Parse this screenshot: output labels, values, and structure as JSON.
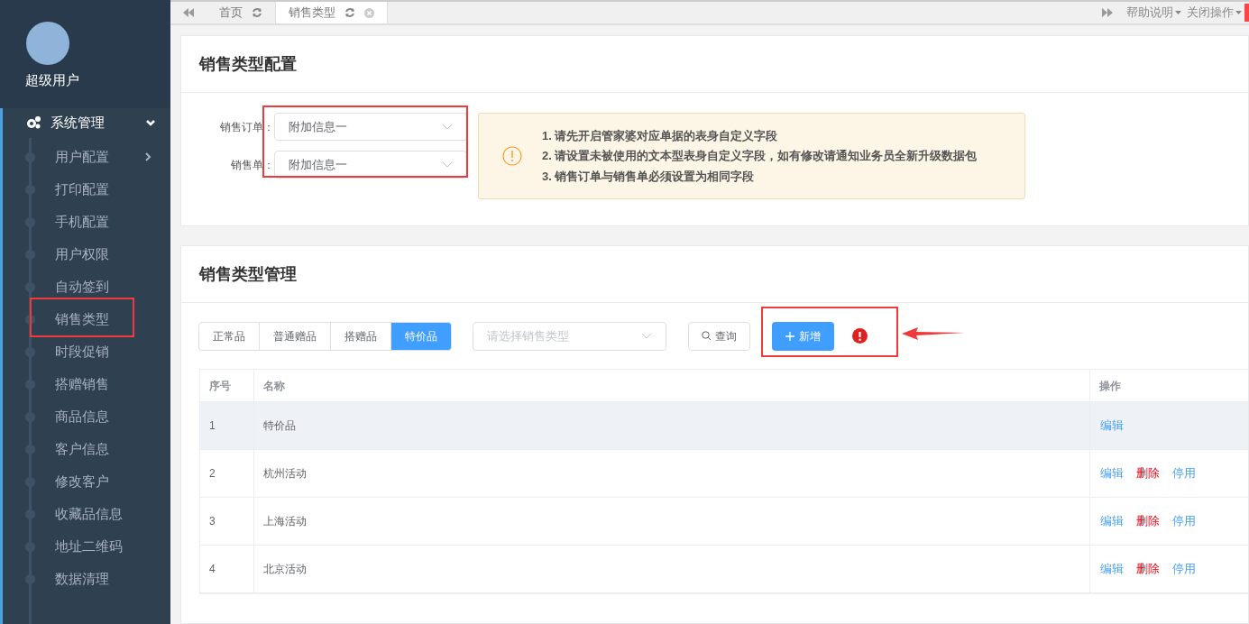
{
  "user": {
    "name": "超级用户"
  },
  "sidebar": {
    "group": {
      "label": "系统管理",
      "expanded": true
    },
    "items": [
      {
        "label": "用户配置",
        "has_children": true,
        "highlighted": false
      },
      {
        "label": "打印配置",
        "has_children": false,
        "highlighted": false
      },
      {
        "label": "手机配置",
        "has_children": false,
        "highlighted": false
      },
      {
        "label": "用户权限",
        "has_children": false,
        "highlighted": false
      },
      {
        "label": "自动签到",
        "has_children": false,
        "highlighted": false
      },
      {
        "label": "销售类型",
        "has_children": false,
        "highlighted": true
      },
      {
        "label": "时段促销",
        "has_children": false,
        "highlighted": false
      },
      {
        "label": "搭赠销售",
        "has_children": false,
        "highlighted": false
      },
      {
        "label": "商品信息",
        "has_children": false,
        "highlighted": false
      },
      {
        "label": "客户信息",
        "has_children": false,
        "highlighted": false
      },
      {
        "label": "修改客户",
        "has_children": false,
        "highlighted": false
      },
      {
        "label": "收藏品信息",
        "has_children": false,
        "highlighted": false
      },
      {
        "label": "地址二维码",
        "has_children": false,
        "highlighted": false
      },
      {
        "label": "数据清理",
        "has_children": false,
        "highlighted": false
      }
    ]
  },
  "tabs": [
    {
      "label": "首页",
      "selected": false,
      "closable": false
    },
    {
      "label": "销售类型",
      "selected": true,
      "closable": true
    }
  ],
  "tab_menus": [
    "帮助说明",
    "关闭操作"
  ],
  "config": {
    "title": "销售类型配置",
    "highlighted": true,
    "fields": [
      {
        "label": "销售订单：",
        "value": "附加信息一"
      },
      {
        "label": "销售单：",
        "value": "附加信息一"
      }
    ],
    "notice": [
      "1. 请先开启管家婆对应单据的表身自定义字段",
      "2. 请设置未被使用的文本型表身自定义字段，如有修改请通知业务员全新升级数据包",
      "3. 销售订单与销售单必须设置为相同字段"
    ]
  },
  "manage": {
    "title": "销售类型管理",
    "segments": [
      {
        "label": "正常品",
        "selected": false
      },
      {
        "label": "普通赠品",
        "selected": false
      },
      {
        "label": "搭赠品",
        "selected": false
      },
      {
        "label": "特价品",
        "selected": true
      }
    ],
    "type_select": {
      "placeholder": "请选择销售类型"
    },
    "query_button": "查询",
    "add_button": "新增",
    "add_highlighted": true,
    "table": {
      "columns": [
        "序号",
        "名称",
        "操作"
      ],
      "rows": [
        {
          "index": "1",
          "name": "特价品",
          "selected": true,
          "actions": [
            {
              "label": "编辑",
              "kind": "edit"
            }
          ]
        },
        {
          "index": "2",
          "name": "杭州活动",
          "selected": false,
          "actions": [
            {
              "label": "编辑",
              "kind": "edit"
            },
            {
              "label": "删除",
              "kind": "delete"
            },
            {
              "label": "停用",
              "kind": "disable"
            }
          ]
        },
        {
          "index": "3",
          "name": "上海活动",
          "selected": false,
          "actions": [
            {
              "label": "编辑",
              "kind": "edit"
            },
            {
              "label": "删除",
              "kind": "delete"
            },
            {
              "label": "停用",
              "kind": "disable"
            }
          ]
        },
        {
          "index": "4",
          "name": "北京活动",
          "selected": false,
          "actions": [
            {
              "label": "编辑",
              "kind": "edit"
            },
            {
              "label": "删除",
              "kind": "delete"
            },
            {
              "label": "停用",
              "kind": "disable"
            }
          ]
        }
      ]
    }
  }
}
